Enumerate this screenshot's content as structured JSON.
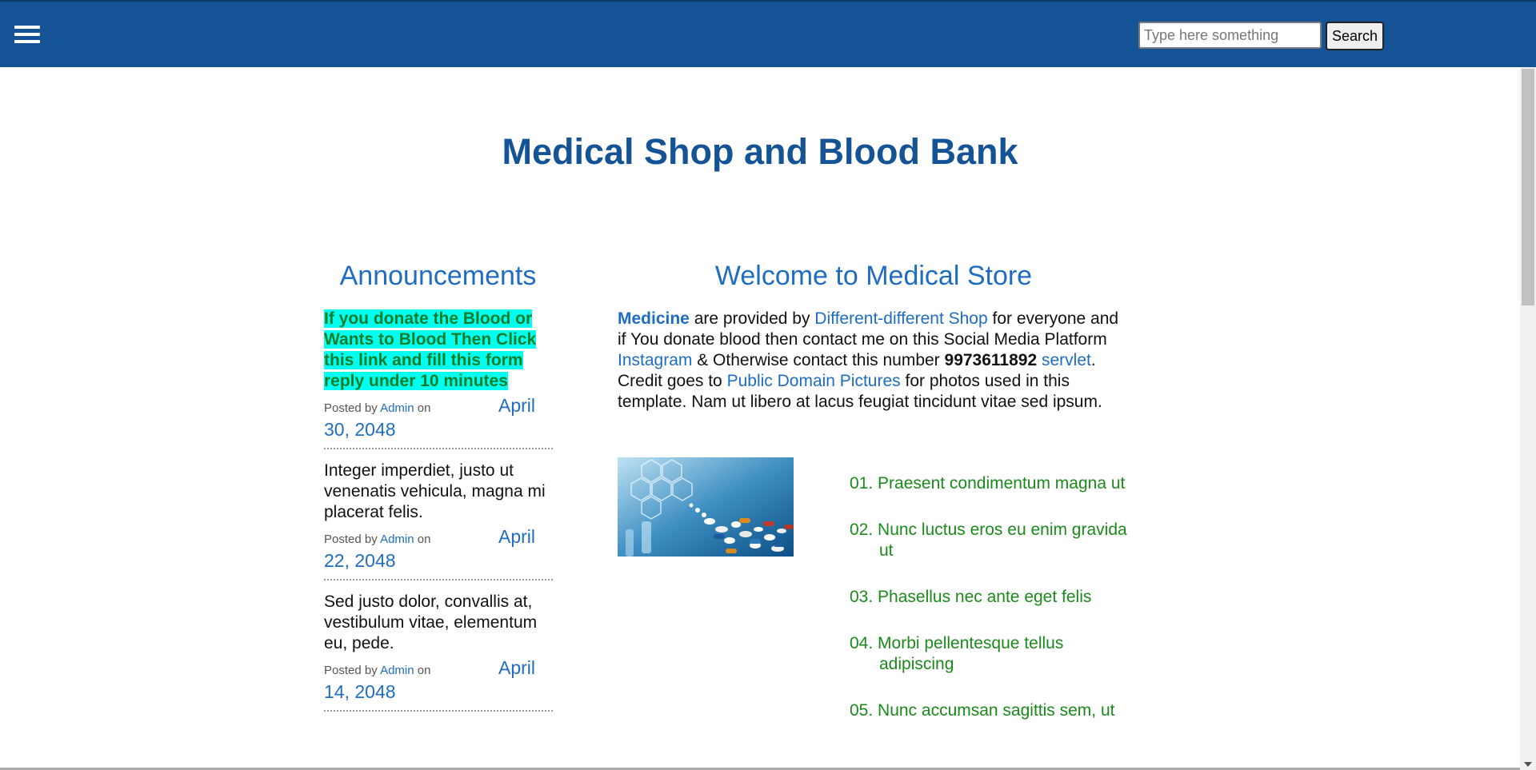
{
  "header": {
    "search_placeholder": "Type here something",
    "search_button": "Search"
  },
  "page_title": "Medical Shop and Blood Bank",
  "announcements": {
    "heading": "Announcements",
    "items": [
      {
        "text": "If you donate the Blood or Wants to Blood Then Click this link and fill this form reply under 10 minutes",
        "posted_by": "Posted by",
        "author": "Admin",
        "on": "on",
        "month": "April",
        "day_year": "30, 2048"
      },
      {
        "text": "Integer imperdiet, justo ut venenatis vehicula, magna mi placerat felis.",
        "posted_by": "Posted by",
        "author": "Admin",
        "on": "on",
        "month": "April",
        "day_year": "22, 2048"
      },
      {
        "text": "Sed justo dolor, convallis at, vestibulum vitae, elementum eu, pede.",
        "posted_by": "Posted by",
        "author": "Admin",
        "on": "on",
        "month": "April",
        "day_year": "14, 2048"
      }
    ]
  },
  "welcome": {
    "heading": "Welcome to Medical Store",
    "medicine": "Medicine",
    "t1": " are provided by ",
    "shop_link": "Different-different Shop",
    "t2": " for everyone and if You donate blood then contact me on this Social Media Platform ",
    "instagram": "Instagram",
    "t3": " & Otherwise contact this number ",
    "phone": "9973611892",
    "servlet": "servlet",
    "t4": ". Credit goes to ",
    "pdp": "Public Domain Pictures",
    "t5": " for photos used in this template. Nam ut libero at lacus feugiat tincidunt vitae sed ipsum."
  },
  "list": [
    "01. Praesent condimentum magna ut",
    "02. Nunc luctus eros eu enim gravida ut",
    "03. Phasellus nec ante eget felis",
    "04. Morbi pellentesque tellus adipiscing",
    "05. Nunc accumsan sagittis sem, ut"
  ],
  "colors": {
    "header_bg": "#145395",
    "link": "#1f6dc2",
    "highlight_bg": "#00ffee",
    "list_green": "#1a8a1a"
  }
}
